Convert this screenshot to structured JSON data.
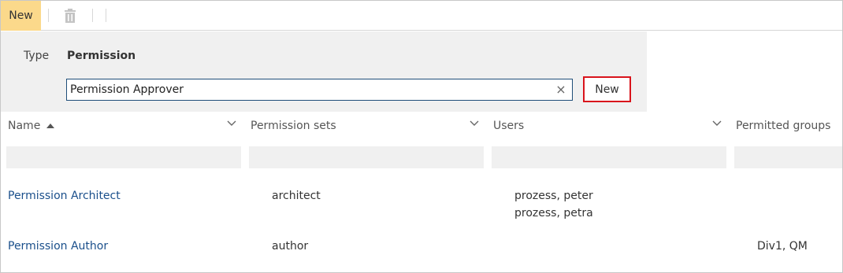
{
  "toolbar": {
    "new_label": "New",
    "delete_icon": "trash-icon"
  },
  "panel": {
    "type_label": "Type",
    "type_value": "Permission",
    "name_input_value": "Permission Approver",
    "clear_icon": "close-icon",
    "clear_glyph": "×",
    "new_button_label": "New",
    "highlight_color": "#d9141c"
  },
  "table": {
    "columns": [
      {
        "label": "Name",
        "sorted": "ascending"
      },
      {
        "label": "Permission sets"
      },
      {
        "label": "Users"
      },
      {
        "label": "Permitted groups"
      }
    ],
    "rows": [
      {
        "name": "Permission Architect",
        "permission_set": "architect",
        "users": [
          "prozess, peter",
          "prozess, petra"
        ],
        "groups": ""
      },
      {
        "name": "Permission Author",
        "permission_set": "author",
        "users": [],
        "groups": "Div1, QM"
      }
    ]
  },
  "colors": {
    "accent_new": "#fbd98b",
    "link": "#1a4f8b",
    "panel_bg": "#f0f0f0"
  }
}
